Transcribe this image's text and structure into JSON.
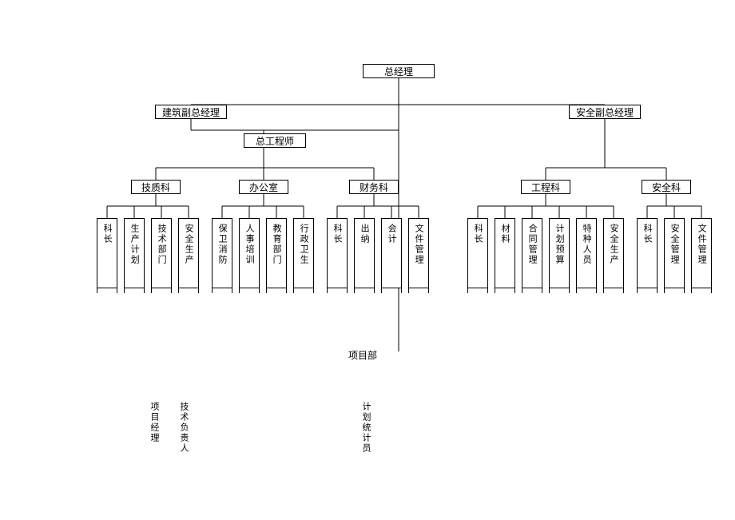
{
  "top": "总经理",
  "vpLeft": "建筑副总经理",
  "vpRight": "安全副总经理",
  "chiefEng": "总工程师",
  "depts": [
    "技质科",
    "办公室",
    "财务科",
    "工程科",
    "安全科"
  ],
  "leaves": {
    "jizhi": [
      "科长",
      "生产计划",
      "技术部门",
      "安全生产"
    ],
    "bangong": [
      "保卫消防",
      "人事培训",
      "教育部门",
      "行政卫生"
    ],
    "caiwu": [
      "科长",
      "出纳",
      "会计",
      "文件管理"
    ],
    "gongcheng": [
      "科长",
      "材料",
      "合同管理",
      "计划预算",
      "特种人员",
      "安全生产"
    ],
    "anquan": [
      "科长",
      "安全管理",
      "文件管理"
    ]
  },
  "projDept": "项目部",
  "staff": [
    "项目经理",
    "技术负责人",
    "计划统计员"
  ]
}
